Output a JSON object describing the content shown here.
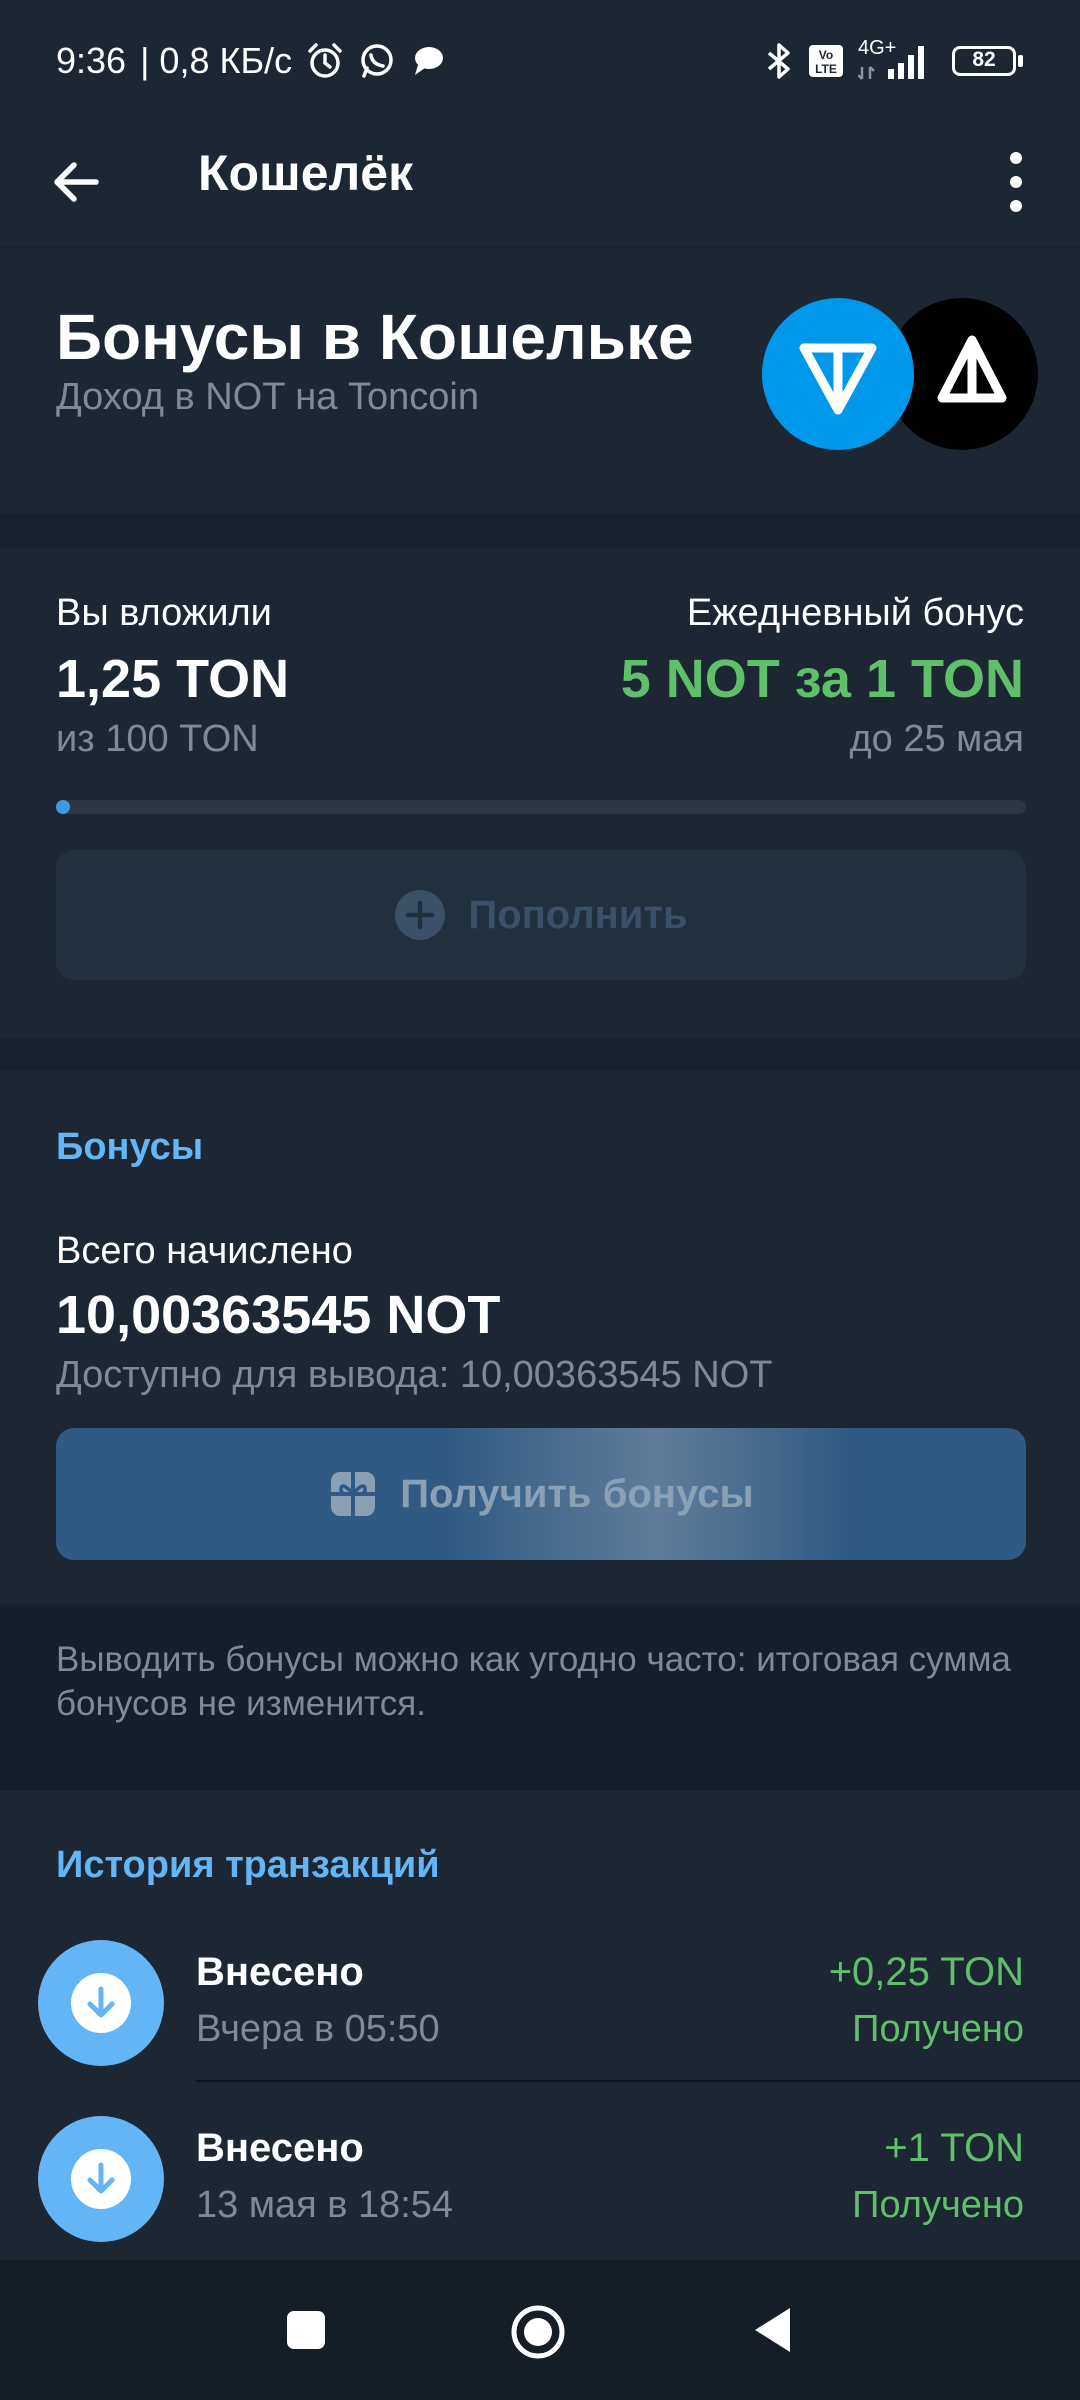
{
  "status_bar": {
    "time": "9:36",
    "speed": "| 0,8 КБ/с",
    "network": "4G+",
    "battery": "82",
    "icons": [
      "alarm-icon",
      "whatsapp-icon",
      "chat-icon",
      "bluetooth-icon",
      "volte-icon",
      "signal-icon",
      "battery-icon"
    ]
  },
  "appbar": {
    "title": "Кошелёк"
  },
  "hero": {
    "title": "Бонусы в Кошельке",
    "subtitle": "Доход в NOT на Toncoin"
  },
  "invest": {
    "left_label": "Вы вложили",
    "amount": "1,25 TON",
    "of_total": "из 100 TON",
    "right_label": "Ежедневный бонус",
    "bonus_rate": "5 NOT за 1 TON",
    "until": "до 25 мая",
    "progress_fraction": 0.0125,
    "topup_label": "Пополнить"
  },
  "bonuses": {
    "section_title": "Бонусы",
    "total_label": "Всего начислено",
    "total_value": "10,00363545 NOT",
    "available": "Доступно для вывода: 10,00363545 NOT",
    "get_label": "Получить бонусы"
  },
  "note": {
    "text": "Выводить бонусы можно как угодно часто: итоговая сумма бонусов не изменится."
  },
  "history": {
    "section_title": "История транзакций",
    "items": [
      {
        "title": "Внесено",
        "date": "Вчера в 05:50",
        "amount": "+0,25 TON",
        "status": "Получено"
      },
      {
        "title": "Внесено",
        "date": "13 мая в 18:54",
        "amount": "+1 TON",
        "status": "Получено"
      }
    ]
  },
  "colors": {
    "background": "#1d2733",
    "accent_blue": "#64b5f6",
    "positive_green": "#5fbf6a",
    "ton_blue": "#0098ea"
  }
}
